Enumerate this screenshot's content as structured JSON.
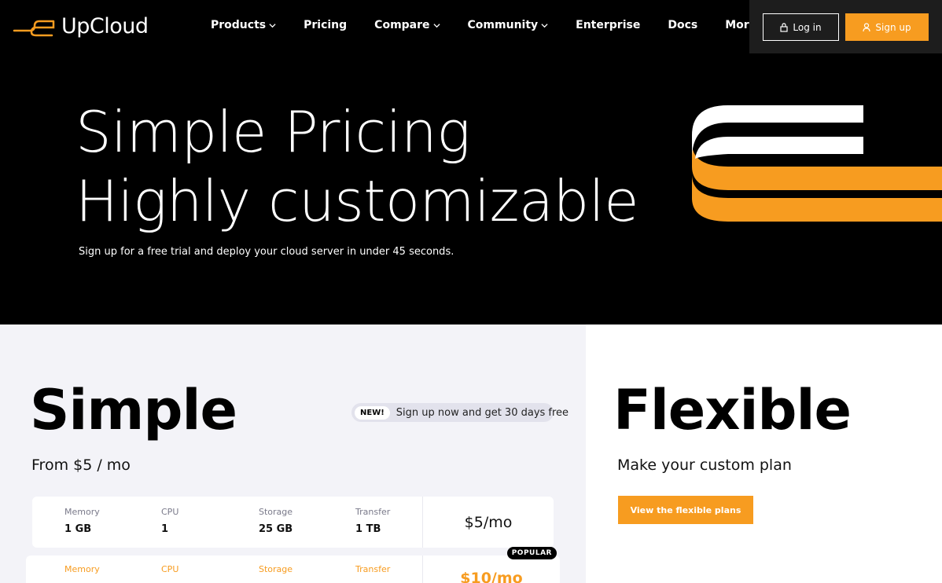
{
  "header": {
    "logo_text": "UpCloud",
    "nav": [
      {
        "label": "Products",
        "has_dropdown": true
      },
      {
        "label": "Pricing",
        "has_dropdown": false
      },
      {
        "label": "Compare",
        "has_dropdown": true
      },
      {
        "label": "Community",
        "has_dropdown": true
      },
      {
        "label": "Enterprise",
        "has_dropdown": false
      },
      {
        "label": "Docs",
        "has_dropdown": false
      },
      {
        "label": "More",
        "has_dropdown": true
      }
    ],
    "login_label": "Log in",
    "signup_label": "Sign up"
  },
  "hero": {
    "title_line1": "Simple Pricing",
    "title_line2": "Highly customizable",
    "subtitle": "Sign up for a free trial and deploy your cloud server in under 45 seconds."
  },
  "simple": {
    "title": "Simple",
    "from_price": "From $5 / mo",
    "new_badge": "NEW!",
    "promo_text": "Sign up now and get 30 days free",
    "plans": [
      {
        "memory_label": "Memory",
        "memory": "1 GB",
        "cpu_label": "CPU",
        "cpu": "1",
        "storage_label": "Storage",
        "storage": "25 GB",
        "transfer_label": "Transfer",
        "transfer": "1 TB",
        "price": "$5/mo"
      },
      {
        "memory_label": "Memory",
        "cpu_label": "CPU",
        "storage_label": "Storage",
        "transfer_label": "Transfer",
        "price": "$10/mo",
        "badge": "POPULAR"
      }
    ]
  },
  "flexible": {
    "title": "Flexible",
    "subtitle": "Make your custom plan",
    "button_label": "View the flexible plans"
  },
  "colors": {
    "accent": "#f79c20",
    "header_bg": "#000000",
    "panel_bg": "#f3f3f8"
  }
}
